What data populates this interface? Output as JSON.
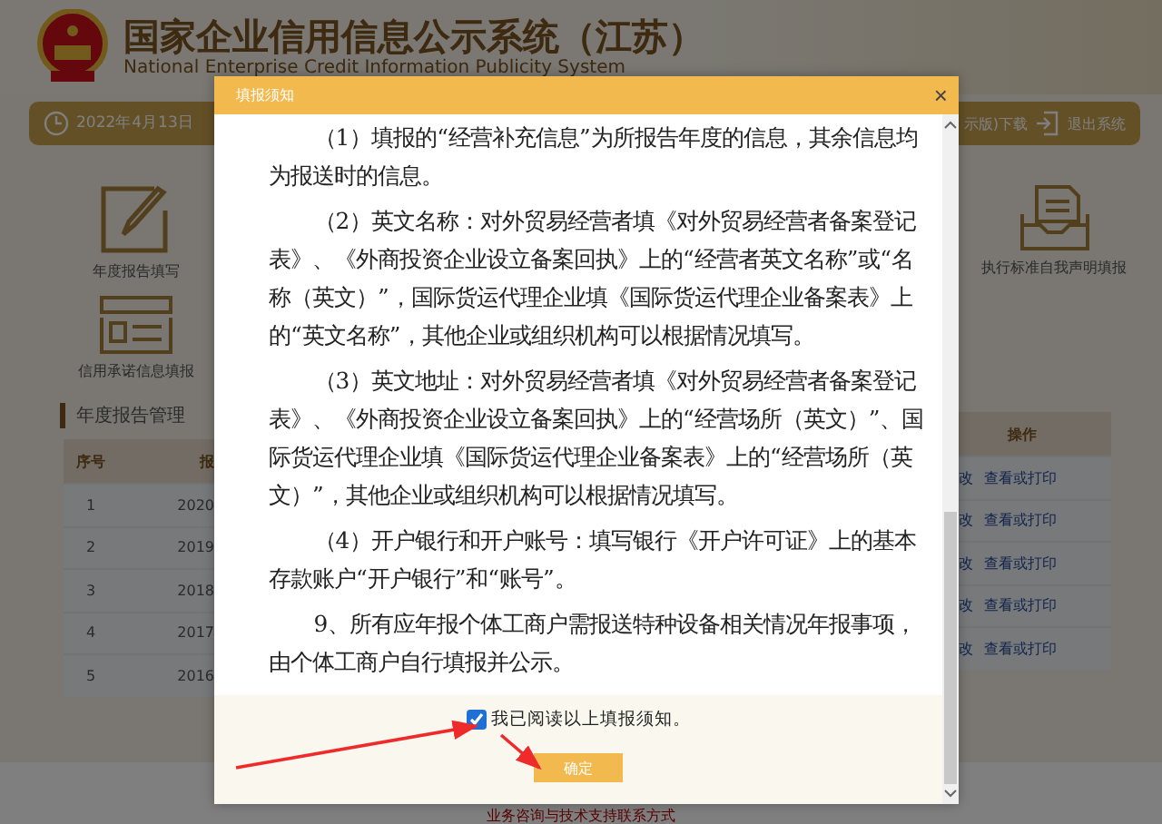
{
  "header": {
    "title": "国家企业信用信息公示系统（江苏）",
    "subtitle": "National Enterprise Credit Information Publicity System"
  },
  "nav": {
    "date": "2022年4月13日",
    "right_items": [
      "示版)下载",
      "退出系统"
    ]
  },
  "tiles": [
    {
      "label": "年度报告填写",
      "kind": "pencil"
    },
    {
      "label": "信用承诺信息填报",
      "kind": "form"
    },
    {
      "label": "执行标准自我声明填报",
      "kind": "tray"
    }
  ],
  "section_title": "年度报告管理",
  "table": {
    "columns": [
      "序号",
      "报",
      "操作"
    ],
    "rows": [
      {
        "index": "1",
        "year": "2020",
        "edit": "改",
        "view": "查看或打印"
      },
      {
        "index": "2",
        "year": "2019",
        "edit": "改",
        "view": "查看或打印"
      },
      {
        "index": "3",
        "year": "2018",
        "edit": "改",
        "view": "查看或打印"
      },
      {
        "index": "4",
        "year": "2017",
        "edit": "改",
        "view": "查看或打印"
      },
      {
        "index": "5",
        "year": "2016",
        "edit": "改",
        "view": "查看或打印"
      }
    ]
  },
  "footer": "业务咨询与技术支持联系方式",
  "dialog": {
    "title": "填报须知",
    "close": "×",
    "paragraphs": [
      "（1）填报的“经营补充信息”为所报告年度的信息，其余信息均为报送时的信息。",
      "（2）英文名称：对外贸易经营者填《对外贸易经营者备案登记表》、《外商投资企业设立备案回执》上的“经营者英文名称”或“名称（英文）”，国际货运代理企业填《国际货运代理企业备案表》上的“英文名称”，其他企业或组织机构可以根据情况填写。",
      "（3）英文地址：对外贸易经营者填《对外贸易经营者备案登记表》、《外商投资企业设立备案回执》上的“经营场所（英文）”、国际货运代理企业填《国际货运代理企业备案表》上的“经营场所（英文）”，其他企业或组织机构可以根据情况填写。",
      "（4）开户银行和开户账号：填写银行《开户许可证》上的基本存款账户“开户银行”和“账号”。",
      "9、所有应年报个体工商户需报送特种设备相关情况年报事项，由个体工商户自行填报并公示。"
    ],
    "agree": {
      "label": "我已阅读以上填报须知。",
      "checked": true
    },
    "confirm": "确定"
  }
}
